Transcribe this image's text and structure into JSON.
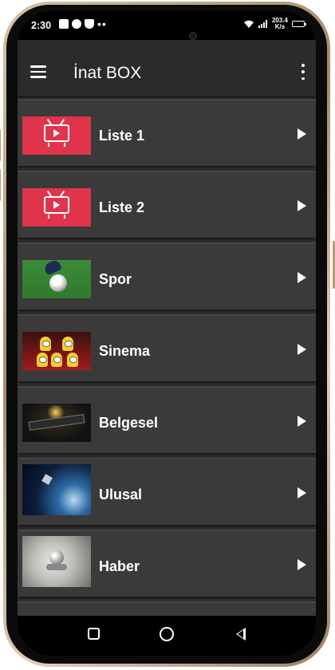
{
  "status_bar": {
    "time": "2:30",
    "net_speed_value": "203.4",
    "net_speed_unit": "K/s",
    "icons": [
      "notes-icon",
      "location-icon",
      "shield-icon",
      "more-dots-icon",
      "wifi-icon",
      "signal-icon",
      "battery-icon"
    ]
  },
  "app_bar": {
    "title": "İnat BOX",
    "menu_icon": "hamburger-menu-icon",
    "overflow_icon": "more-vertical-icon"
  },
  "list": {
    "items": [
      {
        "label": "Liste 1",
        "thumb": "tv-icon"
      },
      {
        "label": "Liste 2",
        "thumb": "tv-icon"
      },
      {
        "label": "Spor",
        "thumb": "football-image"
      },
      {
        "label": "Sinema",
        "thumb": "cinema-minions-image"
      },
      {
        "label": "Belgesel",
        "thumb": "documentary-image"
      },
      {
        "label": "Ulusal",
        "thumb": "earth-satellite-image"
      },
      {
        "label": "Haber",
        "thumb": "news-microphone-image"
      }
    ]
  },
  "nav_bar": {
    "icons": [
      "recents-icon",
      "home-icon",
      "back-icon"
    ]
  },
  "colors": {
    "list_background": "#3a3a3a",
    "app_bar_background": "#2b2b2b",
    "tv_thumb_red": "#e0344c"
  }
}
